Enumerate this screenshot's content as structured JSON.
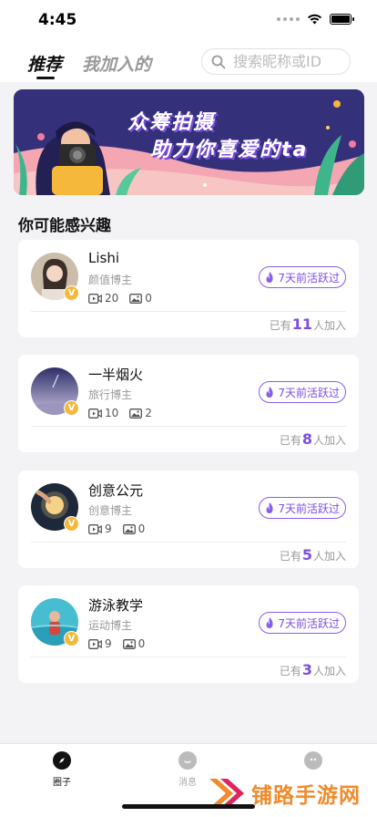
{
  "status": {
    "time": "4:45"
  },
  "header": {
    "tabs": [
      {
        "label": "推荐",
        "active": true
      },
      {
        "label": "我加入的",
        "active": false
      }
    ],
    "search_placeholder": "搜索昵称或ID"
  },
  "banner": {
    "line1": "众筹拍摄",
    "line2": "助力你喜爱的ta"
  },
  "section_title": "你可能感兴趣",
  "cards": [
    {
      "name": "Lishi",
      "tag": "颜值博主",
      "videos": "20",
      "photos": "0",
      "active": "7天前活跃过",
      "join_prefix": "已有",
      "join_count": "11",
      "join_suffix": "人加入",
      "avatar_color": "#c9b9a8"
    },
    {
      "name": "一半烟火",
      "tag": "旅行博主",
      "videos": "10",
      "photos": "2",
      "active": "7天前活跃过",
      "join_prefix": "已有",
      "join_count": "8",
      "join_suffix": "人加入",
      "avatar_color": "#6d6fa3"
    },
    {
      "name": "创意公元",
      "tag": "创意博主",
      "videos": "9",
      "photos": "0",
      "active": "7天前活跃过",
      "join_prefix": "已有",
      "join_count": "5",
      "join_suffix": "人加入",
      "avatar_color": "#1f2b3d"
    },
    {
      "name": "游泳教学",
      "tag": "运动博主",
      "videos": "9",
      "photos": "0",
      "active": "7天前活跃过",
      "join_prefix": "已有",
      "join_count": "3",
      "join_suffix": "人加入",
      "avatar_color": "#3fb3c9"
    }
  ],
  "tabbar": {
    "items": [
      {
        "label": "圈子",
        "icon": "compass-icon"
      },
      {
        "label": "消息",
        "icon": "message-icon"
      },
      {
        "label": "",
        "icon": "profile-icon"
      }
    ]
  },
  "watermark": {
    "text": "铺路手游网"
  },
  "colors": {
    "accent": "#7b4de6",
    "badge": "#f5b83a"
  }
}
